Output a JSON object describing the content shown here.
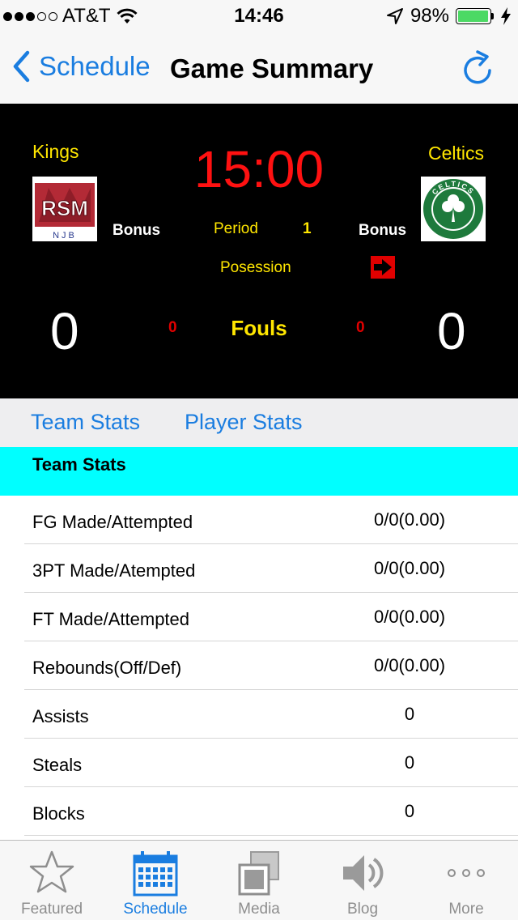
{
  "status_bar": {
    "carrier": "AT&T",
    "time": "14:46",
    "battery": "98%",
    "battery_level": 0.98,
    "signal_bars_filled": 3,
    "signal_bars_total": 5
  },
  "nav": {
    "back_label": "Schedule",
    "title": "Game Summary"
  },
  "scoreboard": {
    "home": {
      "name": "Kings",
      "logo_text": "RSM",
      "logo_subtext": "NJB",
      "bonus_label": "Bonus",
      "score": "0",
      "fouls": "0"
    },
    "away": {
      "name": "Celtics",
      "logo_text": "CELTICS",
      "bonus_label": "Bonus",
      "score": "0",
      "fouls": "0"
    },
    "clock": "15:00",
    "period_label": "Period",
    "period_value": "1",
    "possession_label": "Posession",
    "possession_side": "away",
    "fouls_label": "Fouls"
  },
  "segments": {
    "team_stats": "Team Stats",
    "player_stats": "Player Stats"
  },
  "section": {
    "title": "Team Stats"
  },
  "stats": [
    {
      "label": "FG Made/Attempted",
      "value": "0/0(0.00)"
    },
    {
      "label": "3PT Made/Atempted",
      "value": "0/0(0.00)"
    },
    {
      "label": "FT Made/Attempted",
      "value": "0/0(0.00)"
    },
    {
      "label": "Rebounds(Off/Def)",
      "value": "0/0(0.00)"
    },
    {
      "label": "Assists",
      "value": "0"
    },
    {
      "label": "Steals",
      "value": "0"
    },
    {
      "label": "Blocks",
      "value": "0"
    }
  ],
  "tabbar": {
    "items": [
      {
        "label": "Featured",
        "icon": "star-icon",
        "active": false
      },
      {
        "label": "Schedule",
        "icon": "calendar-icon",
        "active": true
      },
      {
        "label": "Media",
        "icon": "media-icon",
        "active": false
      },
      {
        "label": "Blog",
        "icon": "speaker-icon",
        "active": false
      },
      {
        "label": "More",
        "icon": "more-icon",
        "active": false
      }
    ]
  },
  "colors": {
    "accent": "#1a7de0",
    "scoreboard_bg": "#000000",
    "clock": "#ff1111",
    "scoreboard_text": "#ffe600",
    "section_header": "#00ffff",
    "battery": "#4cd964"
  }
}
